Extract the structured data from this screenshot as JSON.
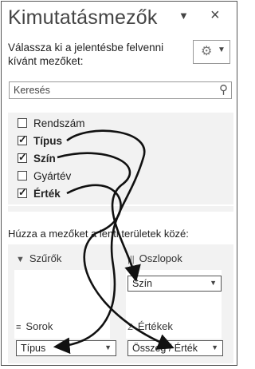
{
  "header": {
    "title": "Kimutatásmezők",
    "title_dropdown_icon": "chevron-down-icon",
    "close_glyph": "×"
  },
  "instruction": "Válassza ki a jelentésbe felvenni kívánt mezőket:",
  "settings": {
    "gear_icon": "gear-icon",
    "dropdown_icon": "chevron-down-icon"
  },
  "search": {
    "placeholder": "Keresés"
  },
  "fields": [
    {
      "label": "Rendszám",
      "checked": false
    },
    {
      "label": "Típus",
      "checked": true
    },
    {
      "label": "Szín",
      "checked": true
    },
    {
      "label": "Gyártév",
      "checked": false
    },
    {
      "label": "Érték",
      "checked": true
    }
  ],
  "drag_hint": "Húzza a mezőket a lenti területek közé:",
  "areas": {
    "filters": {
      "label": "Szűrők",
      "items": []
    },
    "columns": {
      "label": "Oszlopok",
      "items": [
        "Szín"
      ]
    },
    "rows": {
      "label": "Sorok",
      "items": [
        "Típus"
      ]
    },
    "values": {
      "label": "Értékek",
      "items": [
        "Összeg / Érték"
      ]
    }
  }
}
